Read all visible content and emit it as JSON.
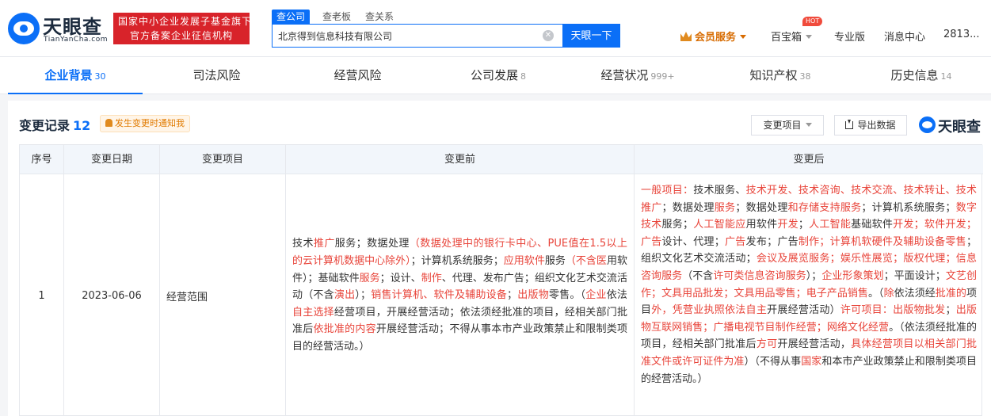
{
  "brand": {
    "name_cn": "天眼查",
    "name_en": "TianYanCha.com",
    "gov_line1": "国家中小企业发展子基金旗下",
    "gov_line2": "官方备案企业征信机构",
    "watermark": "天眼查"
  },
  "search": {
    "tabs": [
      "查公司",
      "查老板",
      "查关系"
    ],
    "value": "北京得到信息科技有限公司",
    "button": "天眼一下"
  },
  "nav": {
    "vip": "会员服务",
    "baibao": "百宝箱",
    "hot": "HOT",
    "pro": "专业版",
    "messages": "消息中心",
    "account": "2813..."
  },
  "category_tabs": [
    {
      "label": "企业背景",
      "count": "30"
    },
    {
      "label": "司法风险",
      "count": ""
    },
    {
      "label": "经营风险",
      "count": ""
    },
    {
      "label": "公司发展",
      "count": "8"
    },
    {
      "label": "经营状况",
      "count": "999+"
    },
    {
      "label": "知识产权",
      "count": "38"
    },
    {
      "label": "历史信息",
      "count": "14"
    }
  ],
  "section": {
    "title": "变更记录",
    "count": "12",
    "notify": "发生变更时通知我",
    "filter": "变更项目",
    "export": "导出数据"
  },
  "table": {
    "headers": [
      "序号",
      "变更日期",
      "变更项目",
      "变更前",
      "变更后"
    ],
    "rows": [
      {
        "index": "1",
        "date": "2023-06-06",
        "item": "经营范围",
        "before": [
          {
            "t": "技术"
          },
          {
            "t": "推广",
            "h": true
          },
          {
            "t": "服务；数据处理"
          },
          {
            "t": "（数据处理中的银行卡中心、PUE值在1.5以上的云计算机数据中心除外）",
            "h": true
          },
          {
            "t": "；计算机系统服务；"
          },
          {
            "t": "应用软件",
            "h": true
          },
          {
            "t": "服务"
          },
          {
            "t": "（不含医",
            "h": true
          },
          {
            "t": "用软件）；基础软件"
          },
          {
            "t": "服务",
            "h": true
          },
          {
            "t": "；设计、"
          },
          {
            "t": "制作",
            "h": true
          },
          {
            "t": "、代理、发布广告；组织文化艺术交流活动（不含"
          },
          {
            "t": "演出",
            "h": true
          },
          {
            "t": "）；"
          },
          {
            "t": "销售计算机、软件及辅助设备",
            "h": true
          },
          {
            "t": "；"
          },
          {
            "t": "出版物",
            "h": true
          },
          {
            "t": "零售。（"
          },
          {
            "t": "企业",
            "h": true
          },
          {
            "t": "依法"
          },
          {
            "t": "自主选择",
            "h": true
          },
          {
            "t": "经营项目，开展经营活动；依法须经批准的项目，经相关部门批准后"
          },
          {
            "t": "依批准的内容",
            "h": true
          },
          {
            "t": "开展经营活动；不得从事本市产业政策禁止和限制类项目的经营活动。）"
          }
        ],
        "after": [
          {
            "t": "一般项目：",
            "h": true
          },
          {
            "t": "技术服务、"
          },
          {
            "t": "技术开发、技术咨询、技术交流、技术转让、技术推广",
            "h": true
          },
          {
            "t": "；数据处理"
          },
          {
            "t": "服务",
            "h": true
          },
          {
            "t": "；数据处理"
          },
          {
            "t": "和存储支持服务",
            "h": true
          },
          {
            "t": "；计算机系统服务；"
          },
          {
            "t": "数字技术",
            "h": true
          },
          {
            "t": "服务；"
          },
          {
            "t": "人工智能应",
            "h": true
          },
          {
            "t": "用软件"
          },
          {
            "t": "开发",
            "h": true
          },
          {
            "t": "；"
          },
          {
            "t": "人工智能",
            "h": true
          },
          {
            "t": "基础软件"
          },
          {
            "t": "开发；软件开发；广告",
            "h": true
          },
          {
            "t": "设计、代理；"
          },
          {
            "t": "广告",
            "h": true
          },
          {
            "t": "发布；广告"
          },
          {
            "t": "制作；计算机软硬件及辅助设备零售",
            "h": true
          },
          {
            "t": "；组织文化艺术交流活动；"
          },
          {
            "t": "会议及展览服务；娱乐性展览；版权代理；信息咨询服务",
            "h": true
          },
          {
            "t": "（不含"
          },
          {
            "t": "许可类信息咨询服务",
            "h": true
          },
          {
            "t": "）；"
          },
          {
            "t": "企业形象策划",
            "h": true
          },
          {
            "t": "；平面设计；"
          },
          {
            "t": "文艺创作；文具用品批发；文具用品零售；电子产品销售",
            "h": true
          },
          {
            "t": "。（"
          },
          {
            "t": "除",
            "h": true
          },
          {
            "t": "依法须经"
          },
          {
            "t": "批准的",
            "h": true
          },
          {
            "t": "项目"
          },
          {
            "t": "外，凭营业执照依法自主",
            "h": true
          },
          {
            "t": "开展经营活动）"
          },
          {
            "t": "许可项目：出版物批发",
            "h": true
          },
          {
            "t": "；"
          },
          {
            "t": "出版物互联网销售；广播电视节目制作经营；网络文化经营",
            "h": true
          },
          {
            "t": "。（依法须经批准的项目，经相关部门批准后"
          },
          {
            "t": "方可",
            "h": true
          },
          {
            "t": "开展经营活动，"
          },
          {
            "t": "具体经营项目以相关部门批准文件或许可证件为准",
            "h": true
          },
          {
            "t": "）（不得从事"
          },
          {
            "t": "国家",
            "h": true
          },
          {
            "t": "和本市产业政策禁止和限制类项目的经营活动。）"
          }
        ]
      }
    ]
  }
}
